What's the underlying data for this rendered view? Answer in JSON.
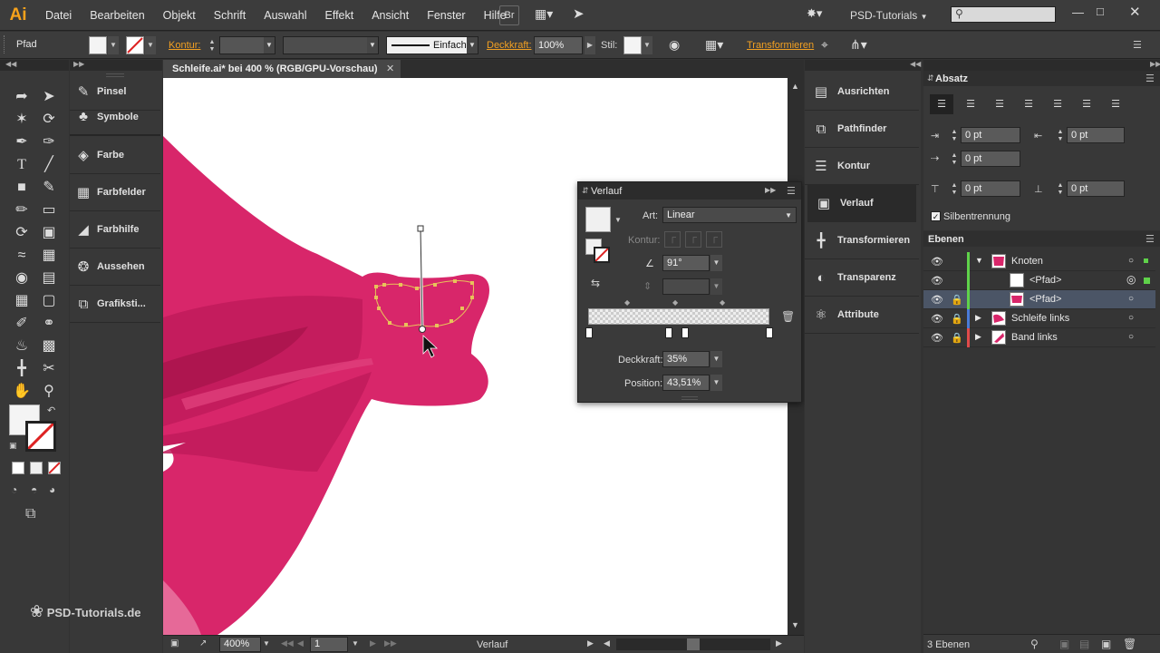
{
  "app": {
    "logo": "Ai",
    "menus": [
      "Datei",
      "Bearbeiten",
      "Objekt",
      "Schrift",
      "Auswahl",
      "Effekt",
      "Ansicht",
      "Fenster",
      "Hilfe"
    ],
    "bridge_label": "Br",
    "workspace": "PSD-Tutorials",
    "search_placeholder": ""
  },
  "control_bar": {
    "object_type": "Pfad",
    "kontur_label": "Kontur:",
    "stroke_style": "Einfach",
    "deckkraft_label": "Deckkraft:",
    "deckkraft_value": "100%",
    "stil_label": "Stil:",
    "transformieren_label": "Transformieren"
  },
  "document": {
    "tab_title": "Schleife.ai* bei 400 % (RGB/GPU-Vorschau)",
    "zoom": "400%",
    "artboard": "1",
    "status": "Verlauf",
    "watermark": "PSD-Tutorials.de",
    "art_color": "#d8266a"
  },
  "left_dock": [
    {
      "label": "Pinsel",
      "icon": "brush-icon"
    },
    {
      "label": "Symbole",
      "icon": "symbols-icon"
    },
    {
      "label": "Farbe",
      "icon": "color-palette-icon"
    },
    {
      "label": "Farbfelder",
      "icon": "swatches-icon"
    },
    {
      "label": "Farbhilfe",
      "icon": "color-guide-icon"
    },
    {
      "label": "Aussehen",
      "icon": "appearance-icon"
    },
    {
      "label": "Grafiksti...",
      "icon": "graphic-styles-icon"
    }
  ],
  "right_dock": [
    {
      "label": "Ausrichten",
      "icon": "align-icon"
    },
    {
      "label": "Pathfinder",
      "icon": "pathfinder-icon"
    },
    {
      "label": "Kontur",
      "icon": "stroke-icon"
    },
    {
      "label": "Verlauf",
      "icon": "gradient-icon"
    },
    {
      "label": "Transformieren",
      "icon": "transform-icon"
    },
    {
      "label": "Transparenz",
      "icon": "transparency-icon"
    },
    {
      "label": "Attribute",
      "icon": "attributes-icon"
    }
  ],
  "gradient_panel": {
    "title": "Verlauf",
    "art_label": "Art:",
    "art_value": "Linear",
    "kontur_label": "Kontur:",
    "angle_value": "91°",
    "deckkraft_label": "Deckkraft:",
    "deckkraft_value": "35%",
    "position_label": "Position:",
    "position_value": "43,51%"
  },
  "paragraph_panel": {
    "title": "Absatz",
    "indent_left": "0 pt",
    "indent_right": "0 pt",
    "first_line": "0 pt",
    "space_before": "0 pt",
    "space_after": "0 pt",
    "hyphenation_label": "Silbentrennung"
  },
  "layers_panel": {
    "title": "Ebenen",
    "rows": [
      {
        "name": "Knoten"
      },
      {
        "name": "<Pfad>"
      },
      {
        "name": "<Pfad>"
      },
      {
        "name": "Schleife links"
      },
      {
        "name": "Band links"
      }
    ],
    "count": "3 Ebenen"
  }
}
